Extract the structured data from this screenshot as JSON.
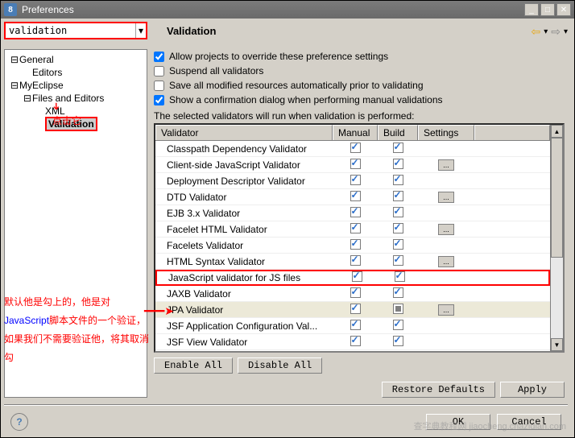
{
  "window": {
    "title": "Preferences"
  },
  "search": {
    "value": "validation"
  },
  "header": {
    "title": "Validation"
  },
  "tree": {
    "nodes": [
      {
        "label": "General",
        "toggle": "−",
        "indent": 0
      },
      {
        "label": "Editors",
        "toggle": "",
        "indent": 1
      },
      {
        "label": "MyEclipse",
        "toggle": "−",
        "indent": 0
      },
      {
        "label": "Files and Editors",
        "toggle": "−",
        "indent": 1
      },
      {
        "label": "XML",
        "toggle": "",
        "indent": 2
      },
      {
        "label": "Validation",
        "toggle": "",
        "indent": 2,
        "selected": true
      }
    ]
  },
  "annotations": {
    "clickIt": "点击它",
    "jsNote_pre": "默认他是勾上的，他是对",
    "jsNote_js": "JavaScript",
    "jsNote_mid": "脚本文件的一个验证，如果我们不需要验证他，将其取消勾"
  },
  "options": {
    "allowOverride": "Allow projects to override these preference settings",
    "suspend": "Suspend all validators",
    "saveAll": "Save all modified resources automatically prior to validating",
    "showConfirm": "Show a confirmation dialog when performing manual validations",
    "tableDesc": "The selected validators will run when validation is performed:"
  },
  "table": {
    "headers": {
      "validator": "Validator",
      "manual": "Manual",
      "build": "Build",
      "settings": "Settings"
    },
    "rows": [
      {
        "name": "Classpath Dependency Validator",
        "manual": true,
        "build": true,
        "settings": false
      },
      {
        "name": "Client-side JavaScript Validator",
        "manual": true,
        "build": true,
        "settings": true
      },
      {
        "name": "Deployment Descriptor Validator",
        "manual": true,
        "build": true,
        "settings": false
      },
      {
        "name": "DTD Validator",
        "manual": true,
        "build": true,
        "settings": true
      },
      {
        "name": "EJB 3.x Validator",
        "manual": true,
        "build": true,
        "settings": false
      },
      {
        "name": "Facelet HTML Validator",
        "manual": true,
        "build": true,
        "settings": true
      },
      {
        "name": "Facelets Validator",
        "manual": true,
        "build": true,
        "settings": false
      },
      {
        "name": "HTML Syntax Validator",
        "manual": true,
        "build": true,
        "settings": true
      },
      {
        "name": "JavaScript validator for JS files",
        "manual": true,
        "build": true,
        "settings": false,
        "highlighted": true
      },
      {
        "name": "JAXB Validator",
        "manual": true,
        "build": true,
        "settings": false
      },
      {
        "name": "JPA Validator",
        "manual": true,
        "buildBox": true,
        "settings": true,
        "selected": true
      },
      {
        "name": "JSF Application Configuration Val...",
        "manual": true,
        "build": true,
        "settings": false
      },
      {
        "name": "JSF View Validator",
        "manual": true,
        "build": true,
        "settings": false
      }
    ]
  },
  "buttons": {
    "enableAll": "Enable All",
    "disableAll": "Disable All",
    "restoreDefaults": "Restore Defaults",
    "apply": "Apply",
    "ok": "OK",
    "cancel": "Cancel"
  },
  "watermark": "查字典教程网 jiaocheng.chazidian.com"
}
